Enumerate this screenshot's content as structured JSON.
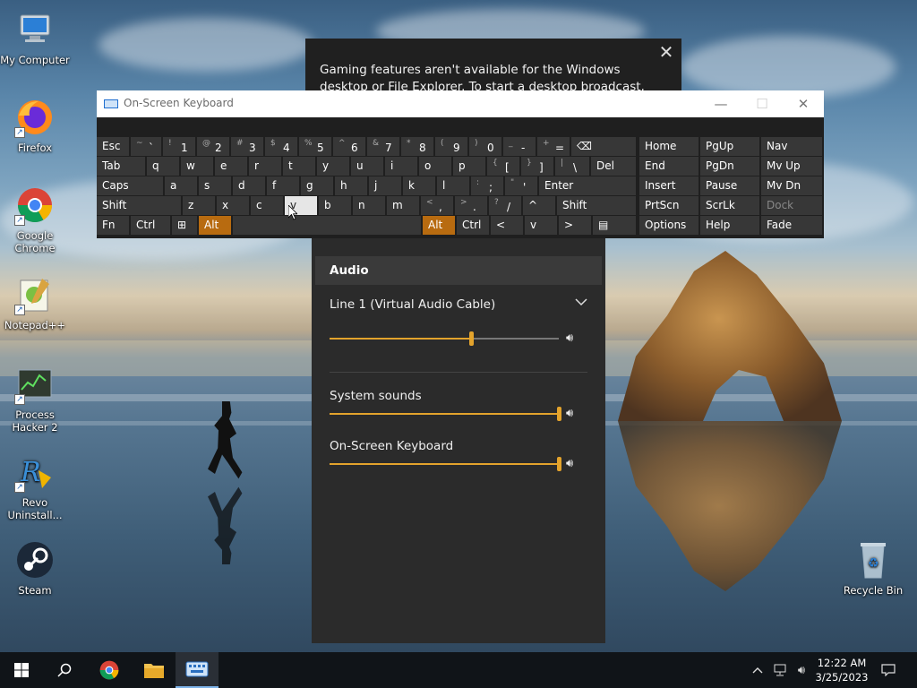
{
  "desktop": {
    "icons": [
      {
        "label": "My Computer"
      },
      {
        "label": "Firefox"
      },
      {
        "label": "Google Chrome"
      },
      {
        "label": "Notepad++"
      },
      {
        "label": "Process Hacker 2"
      },
      {
        "label": "Revo Uninstall..."
      },
      {
        "label": "Steam"
      },
      {
        "label": "Recycle Bin"
      }
    ]
  },
  "gamebar": {
    "message": "Gaming features aren't available for the Windows desktop or File Explorer. To start a desktop broadcast, launch a game, and",
    "audio": {
      "header": "Audio",
      "device": "Line 1 (Virtual Audio Cable)",
      "device_level": 0.62,
      "apps": [
        {
          "label": "System sounds",
          "level": 1.0
        },
        {
          "label": "On-Screen Keyboard",
          "level": 1.0
        }
      ]
    }
  },
  "osk": {
    "title": "On-Screen Keyboard",
    "row1": [
      {
        "label": "Esc"
      },
      {
        "alt": "~",
        "main": "`"
      },
      {
        "alt": "!",
        "main": "1"
      },
      {
        "alt": "@",
        "main": "2"
      },
      {
        "alt": "#",
        "main": "3"
      },
      {
        "alt": "$",
        "main": "4"
      },
      {
        "alt": "%",
        "main": "5"
      },
      {
        "alt": "^",
        "main": "6"
      },
      {
        "alt": "&",
        "main": "7"
      },
      {
        "alt": "*",
        "main": "8"
      },
      {
        "alt": "(",
        "main": "9"
      },
      {
        "alt": ")",
        "main": "0"
      },
      {
        "alt": "_",
        "main": "-"
      },
      {
        "alt": "+",
        "main": "="
      },
      {
        "label": "⌫"
      }
    ],
    "row2": [
      {
        "label": "Tab"
      },
      {
        "label": "q"
      },
      {
        "label": "w"
      },
      {
        "label": "e"
      },
      {
        "label": "r"
      },
      {
        "label": "t"
      },
      {
        "label": "y"
      },
      {
        "label": "u"
      },
      {
        "label": "i"
      },
      {
        "label": "o"
      },
      {
        "label": "p"
      },
      {
        "alt": "{",
        "main": "["
      },
      {
        "alt": "}",
        "main": "]"
      },
      {
        "alt": "|",
        "main": "\\"
      },
      {
        "label": "Del"
      }
    ],
    "row3": [
      {
        "label": "Caps"
      },
      {
        "label": "a"
      },
      {
        "label": "s"
      },
      {
        "label": "d"
      },
      {
        "label": "f"
      },
      {
        "label": "g"
      },
      {
        "label": "h"
      },
      {
        "label": "j"
      },
      {
        "label": "k"
      },
      {
        "label": "l"
      },
      {
        "alt": ":",
        "main": ";"
      },
      {
        "alt": "\"",
        "main": "'"
      },
      {
        "label": "Enter"
      }
    ],
    "row4": [
      {
        "label": "Shift"
      },
      {
        "label": "z"
      },
      {
        "label": "x"
      },
      {
        "label": "c"
      },
      {
        "label": "v"
      },
      {
        "label": "b"
      },
      {
        "label": "n"
      },
      {
        "label": "m"
      },
      {
        "alt": "<",
        "main": ","
      },
      {
        "alt": ">",
        "main": "."
      },
      {
        "alt": "?",
        "main": "/"
      },
      {
        "label": "^"
      },
      {
        "label": "Shift"
      }
    ],
    "row5": [
      {
        "label": "Fn"
      },
      {
        "label": "Ctrl"
      },
      {
        "label": "⊞"
      },
      {
        "label": "Alt"
      },
      {
        "label": ""
      },
      {
        "label": "Alt"
      },
      {
        "label": "Ctrl"
      },
      {
        "label": "<"
      },
      {
        "label": "v"
      },
      {
        "label": ">"
      },
      {
        "label": "▤"
      }
    ],
    "nav": [
      [
        "Home",
        "PgUp",
        "Nav"
      ],
      [
        "End",
        "PgDn",
        "Mv Up"
      ],
      [
        "Insert",
        "Pause",
        "Mv Dn"
      ],
      [
        "PrtScn",
        "ScrLk",
        "Dock"
      ],
      [
        "Options",
        "Help",
        "Fade"
      ]
    ]
  },
  "taskbar": {
    "time": "12:22 AM",
    "date": "3/25/2023"
  },
  "colors": {
    "accent_orange": "#e3a32c",
    "key_orange": "#b86b10",
    "panel_dark": "#2b2b2b"
  }
}
